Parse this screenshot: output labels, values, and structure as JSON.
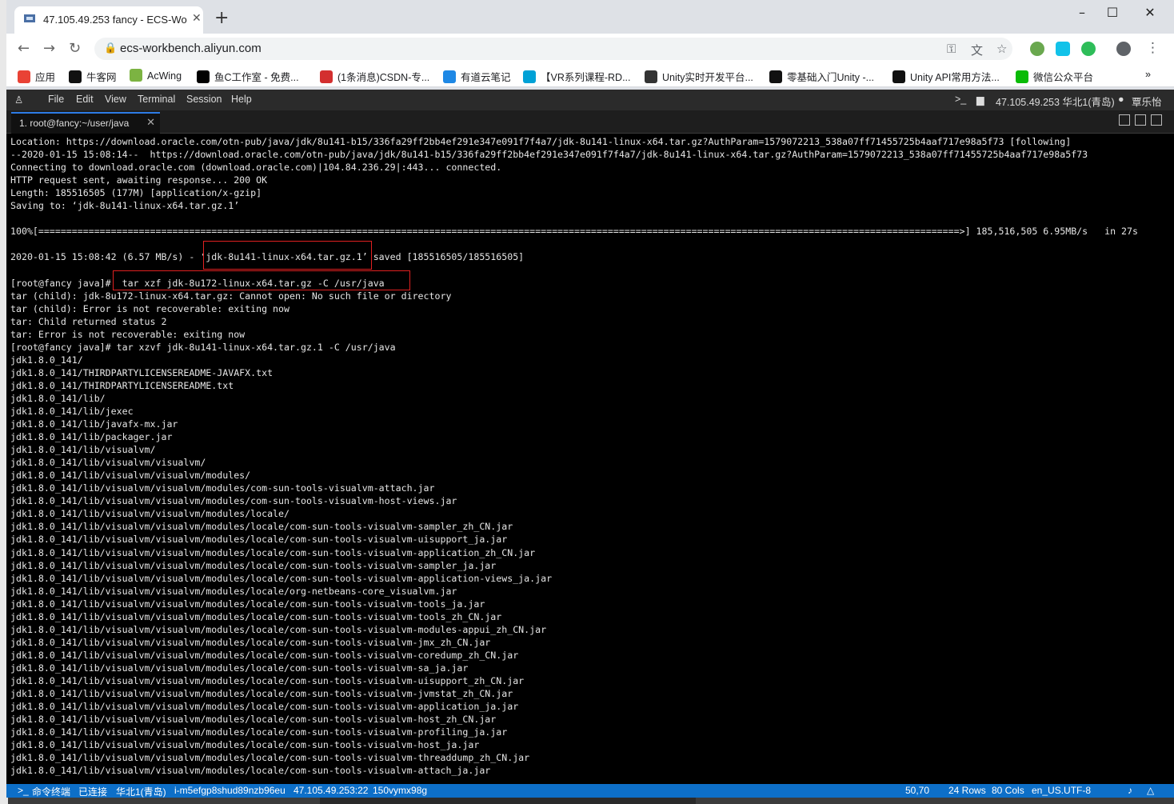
{
  "browser": {
    "tab_title": "47.105.49.253 fancy - ECS-Wo",
    "url": "ecs-workbench.aliyun.com",
    "new_tab": "+",
    "minimize": "–",
    "maximize": "☐",
    "close": "✕"
  },
  "bookmarks": [
    {
      "label": "应用",
      "color": "#e94235"
    },
    {
      "label": "牛客网",
      "color": "#111111"
    },
    {
      "label": "AcWing",
      "color": "#7cb342"
    },
    {
      "label": "鱼C工作室 - 免费...",
      "color": "#000000"
    },
    {
      "label": "(1条消息)CSDN-专...",
      "color": "#d32f2f"
    },
    {
      "label": "有道云笔记",
      "color": "#1e88e5"
    },
    {
      "label": "【VR系列课程-RD...",
      "color": "#00a1d6"
    },
    {
      "label": "Unity实时开发平台...",
      "color": "#333333"
    },
    {
      "label": "零基础入门Unity -...",
      "color": "#111111"
    },
    {
      "label": "Unity API常用方法...",
      "color": "#111111"
    },
    {
      "label": "微信公众平台",
      "color": "#09bb07"
    }
  ],
  "bookmarks_more": "»",
  "app_menu": {
    "items": [
      "File",
      "Edit",
      "View",
      "Terminal",
      "Session",
      "Help"
    ],
    "server": "47.105.49.253 华北1(青岛)",
    "user": "覃乐怡"
  },
  "terminal_tab": {
    "label": "1. root@fancy:~/user/java",
    "close": "✕"
  },
  "terminal_lines": [
    "Location: https://download.oracle.com/otn-pub/java/jdk/8u141-b15/336fa29ff2bb4ef291e347e091f7f4a7/jdk-8u141-linux-x64.tar.gz?AuthParam=1579072213_538a07ff71455725b4aaf717e98a5f73 [following]",
    "--2020-01-15 15:08:14--  https://download.oracle.com/otn-pub/java/jdk/8u141-b15/336fa29ff2bb4ef291e347e091f7f4a7/jdk-8u141-linux-x64.tar.gz?AuthParam=1579072213_538a07ff71455725b4aaf717e98a5f73",
    "Connecting to download.oracle.com (download.oracle.com)|104.84.236.29|:443... connected.",
    "HTTP request sent, awaiting response... 200 OK",
    "Length: 185516505 (177M) [application/x-gzip]",
    "Saving to: ‘jdk-8u141-linux-x64.tar.gz.1’",
    "",
    "100%[=====================================================================================================================================================================>] 185,516,505 6.95MB/s   in 27s",
    "",
    "2020-01-15 15:08:42 (6.57 MB/s) - ‘jdk-8u141-linux-x64.tar.gz.1’ saved [185516505/185516505]",
    "",
    "[root@fancy java]#  tar xzf jdk-8u172-linux-x64.tar.gz -C /usr/java",
    "tar (child): jdk-8u172-linux-x64.tar.gz: Cannot open: No such file or directory",
    "tar (child): Error is not recoverable: exiting now",
    "tar: Child returned status 2",
    "tar: Error is not recoverable: exiting now",
    "[root@fancy java]# tar xzvf jdk-8u141-linux-x64.tar.gz.1 -C /usr/java",
    "jdk1.8.0_141/",
    "jdk1.8.0_141/THIRDPARTYLICENSEREADME-JAVAFX.txt",
    "jdk1.8.0_141/THIRDPARTYLICENSEREADME.txt",
    "jdk1.8.0_141/lib/",
    "jdk1.8.0_141/lib/jexec",
    "jdk1.8.0_141/lib/javafx-mx.jar",
    "jdk1.8.0_141/lib/packager.jar",
    "jdk1.8.0_141/lib/visualvm/",
    "jdk1.8.0_141/lib/visualvm/visualvm/",
    "jdk1.8.0_141/lib/visualvm/visualvm/modules/",
    "jdk1.8.0_141/lib/visualvm/visualvm/modules/com-sun-tools-visualvm-attach.jar",
    "jdk1.8.0_141/lib/visualvm/visualvm/modules/com-sun-tools-visualvm-host-views.jar",
    "jdk1.8.0_141/lib/visualvm/visualvm/modules/locale/",
    "jdk1.8.0_141/lib/visualvm/visualvm/modules/locale/com-sun-tools-visualvm-sampler_zh_CN.jar",
    "jdk1.8.0_141/lib/visualvm/visualvm/modules/locale/com-sun-tools-visualvm-uisupport_ja.jar",
    "jdk1.8.0_141/lib/visualvm/visualvm/modules/locale/com-sun-tools-visualvm-application_zh_CN.jar",
    "jdk1.8.0_141/lib/visualvm/visualvm/modules/locale/com-sun-tools-visualvm-sampler_ja.jar",
    "jdk1.8.0_141/lib/visualvm/visualvm/modules/locale/com-sun-tools-visualvm-application-views_ja.jar",
    "jdk1.8.0_141/lib/visualvm/visualvm/modules/locale/org-netbeans-core_visualvm.jar",
    "jdk1.8.0_141/lib/visualvm/visualvm/modules/locale/com-sun-tools-visualvm-tools_ja.jar",
    "jdk1.8.0_141/lib/visualvm/visualvm/modules/locale/com-sun-tools-visualvm-tools_zh_CN.jar",
    "jdk1.8.0_141/lib/visualvm/visualvm/modules/locale/com-sun-tools-visualvm-modules-appui_zh_CN.jar",
    "jdk1.8.0_141/lib/visualvm/visualvm/modules/locale/com-sun-tools-visualvm-jmx_zh_CN.jar",
    "jdk1.8.0_141/lib/visualvm/visualvm/modules/locale/com-sun-tools-visualvm-coredump_zh_CN.jar",
    "jdk1.8.0_141/lib/visualvm/visualvm/modules/locale/com-sun-tools-visualvm-sa_ja.jar",
    "jdk1.8.0_141/lib/visualvm/visualvm/modules/locale/com-sun-tools-visualvm-uisupport_zh_CN.jar",
    "jdk1.8.0_141/lib/visualvm/visualvm/modules/locale/com-sun-tools-visualvm-jvmstat_zh_CN.jar",
    "jdk1.8.0_141/lib/visualvm/visualvm/modules/locale/com-sun-tools-visualvm-application_ja.jar",
    "jdk1.8.0_141/lib/visualvm/visualvm/modules/locale/com-sun-tools-visualvm-host_zh_CN.jar",
    "jdk1.8.0_141/lib/visualvm/visualvm/modules/locale/com-sun-tools-visualvm-profiling_ja.jar",
    "jdk1.8.0_141/lib/visualvm/visualvm/modules/locale/com-sun-tools-visualvm-host_ja.jar",
    "jdk1.8.0_141/lib/visualvm/visualvm/modules/locale/com-sun-tools-visualvm-threaddump_zh_CN.jar",
    "jdk1.8.0_141/lib/visualvm/visualvm/modules/locale/com-sun-tools-visualvm-attach_ja.jar"
  ],
  "status_bar": {
    "terminal": "命令终端",
    "connected": "已连接",
    "region": "华北1(青岛)",
    "instance": "i-m5efgp8shud89nzb96eu",
    "ip": "47.105.49.253:22",
    "id": "150vymx98g",
    "cursor": "50,70",
    "rows": "24 Rows",
    "cols": "80 Cols",
    "encoding": "en_US.UTF-8"
  },
  "colors": {
    "accent": "#0d6fc8",
    "highlight_box": "#e02020",
    "terminal_bg": "#000000"
  }
}
